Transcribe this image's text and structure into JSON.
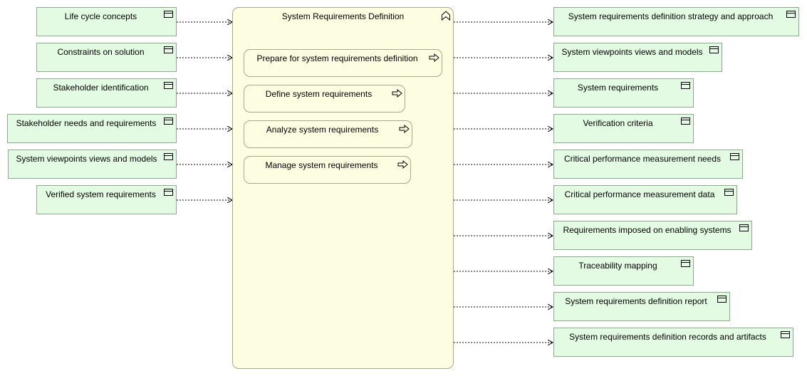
{
  "function": {
    "title": "System Requirements Definition",
    "icon": "function-chevron-icon",
    "processes": [
      "Prepare for system requirements definition",
      "Define system requirements",
      "Analyze system requirements",
      "Manage system requirements"
    ]
  },
  "inputs": [
    "Life cycle concepts",
    "Constraints on solution",
    "Stakeholder identification",
    "Stakeholder needs and requirements",
    "System viewpoints views and models",
    "Verified system requirements"
  ],
  "outputs": [
    "System requirements definition strategy and approach",
    "System viewpoints views and models",
    "System requirements",
    "Verification criteria",
    "Critical performance measurement needs",
    "Critical performance measurement data",
    "Requirements imposed on enabling systems",
    "Traceability mapping",
    "System requirements definition report",
    "System requirements definition records and artifacts"
  ],
  "colors": {
    "business_object_fill": "#e3fbe3",
    "function_fill": "#fdfde2",
    "connector": "#000000"
  }
}
